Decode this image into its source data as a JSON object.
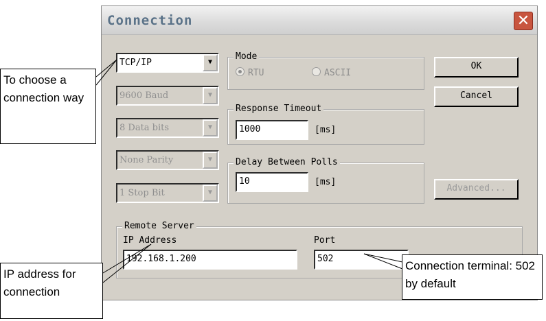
{
  "window": {
    "title": "Connection",
    "close_glyph": "✕"
  },
  "left_combos": [
    {
      "value": "TCP/IP",
      "enabled": true
    },
    {
      "value": "9600 Baud",
      "enabled": false
    },
    {
      "value": "8 Data bits",
      "enabled": false
    },
    {
      "value": "None Parity",
      "enabled": false
    },
    {
      "value": "1 Stop Bit",
      "enabled": false
    }
  ],
  "mode": {
    "label": "Mode",
    "options": [
      "RTU",
      "ASCII"
    ],
    "selected": "RTU",
    "enabled": false
  },
  "response_timeout": {
    "label": "Response Timeout",
    "value": "1000",
    "unit": "[ms]"
  },
  "delay_between_polls": {
    "label": "Delay Between Polls",
    "value": "10",
    "unit": "[ms]"
  },
  "buttons": {
    "ok": "OK",
    "cancel": "Cancel",
    "advanced": "Advanced..."
  },
  "remote_server": {
    "label": "Remote Server",
    "ip_label": "IP Address",
    "ip_value": "192.168.1.200",
    "port_label": "Port",
    "port_value": "502"
  },
  "annotations": {
    "connection_way": "To choose a connection way",
    "ip": "IP address for connection",
    "port": "Connection terminal: 502 by default"
  },
  "colors": {
    "dialog_bg": "#d4d0c8",
    "title_text": "#5a7288",
    "close_button": "#c8553f"
  }
}
